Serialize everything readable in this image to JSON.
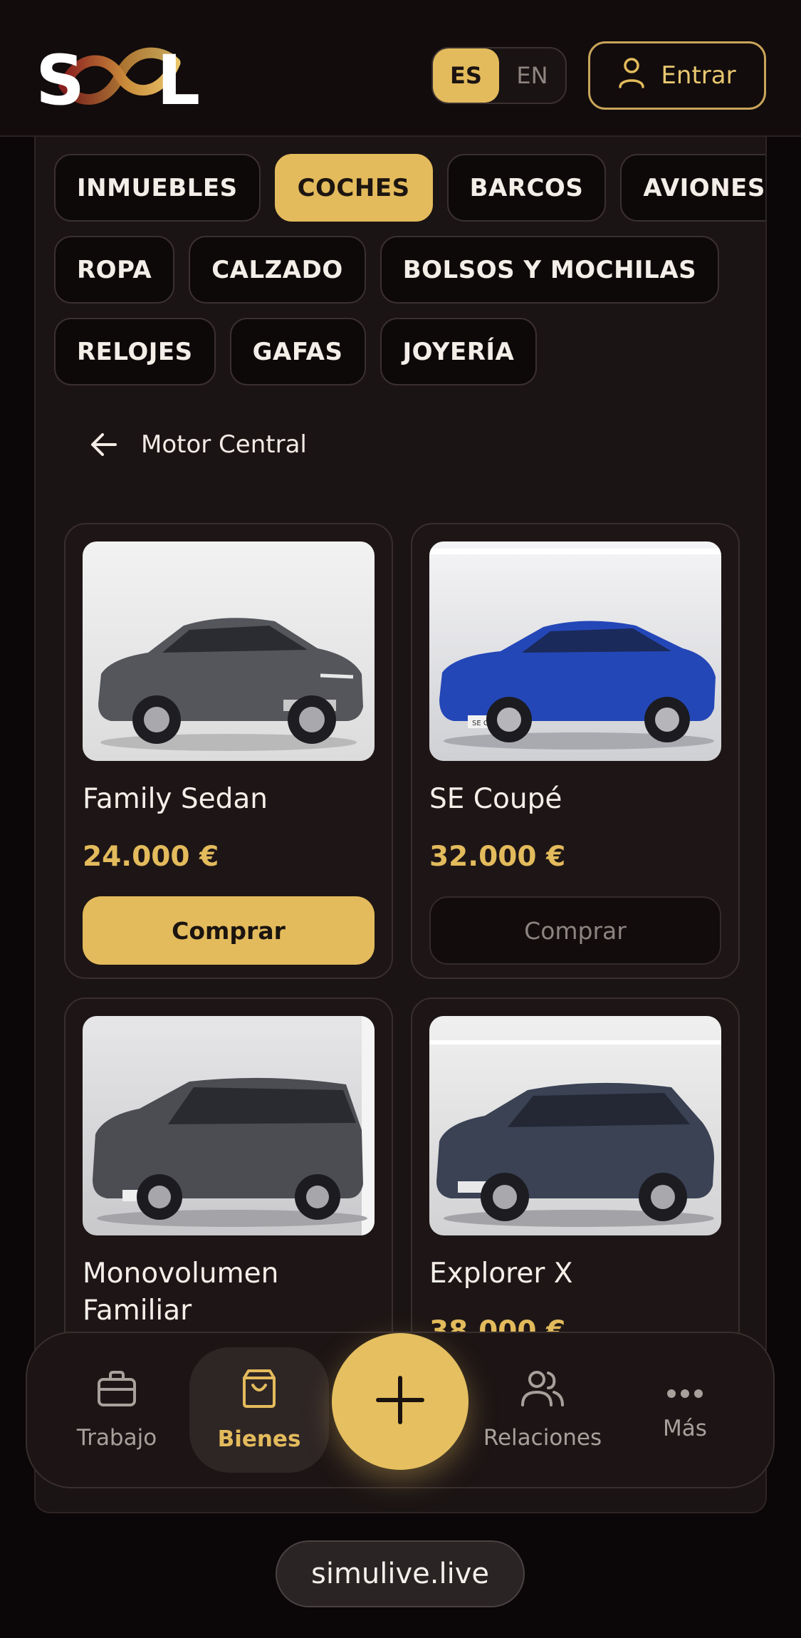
{
  "header": {
    "logo_text": "SOL",
    "lang": {
      "options": [
        "ES",
        "EN"
      ],
      "selected": "ES"
    },
    "login_label": "Entrar"
  },
  "categories": {
    "rows": [
      [
        "INMUEBLES",
        "COCHES",
        "BARCOS",
        "AVIONES"
      ],
      [
        "ROPA",
        "CALZADO",
        "BOLSOS Y MOCHILAS"
      ],
      [
        "RELOJES",
        "GAFAS",
        "JOYERÍA"
      ]
    ],
    "selected": "COCHES"
  },
  "breadcrumb": {
    "label": "Motor Central"
  },
  "products": [
    {
      "name": "Family Sedan",
      "price": "24.000 €",
      "buy_label": "Comprar",
      "buy_enabled": true,
      "car_color": "#55565c",
      "plate": ""
    },
    {
      "name": "SE Coupé",
      "price": "32.000 €",
      "buy_label": "Comprar",
      "buy_enabled": false,
      "car_color": "#2447b8",
      "plate": "SE COUPE"
    },
    {
      "name": "Monovolumen Familiar",
      "price": "",
      "buy_label": "",
      "buy_enabled": false,
      "car_color": "#4c4d53",
      "plate": "FAMILY VAN"
    },
    {
      "name": "Explorer X",
      "price": "38.000 €",
      "buy_label": "",
      "buy_enabled": false,
      "car_color": "#3a4254",
      "plate": "EXPLORER X"
    }
  ],
  "bottom_nav": {
    "items": [
      {
        "label": "Trabajo",
        "icon": "briefcase-icon"
      },
      {
        "label": "Bienes",
        "icon": "shopping-bag-icon"
      },
      {
        "label": "Relaciones",
        "icon": "users-icon"
      },
      {
        "label": "Más",
        "icon": "more-dots-icon"
      }
    ],
    "active": "Bienes",
    "fab_icon": "plus-icon"
  },
  "footer": {
    "domain": "simulive.live"
  },
  "colors": {
    "accent": "#e3bb5c",
    "background": "#0b0708",
    "panel": "#1b1414"
  }
}
